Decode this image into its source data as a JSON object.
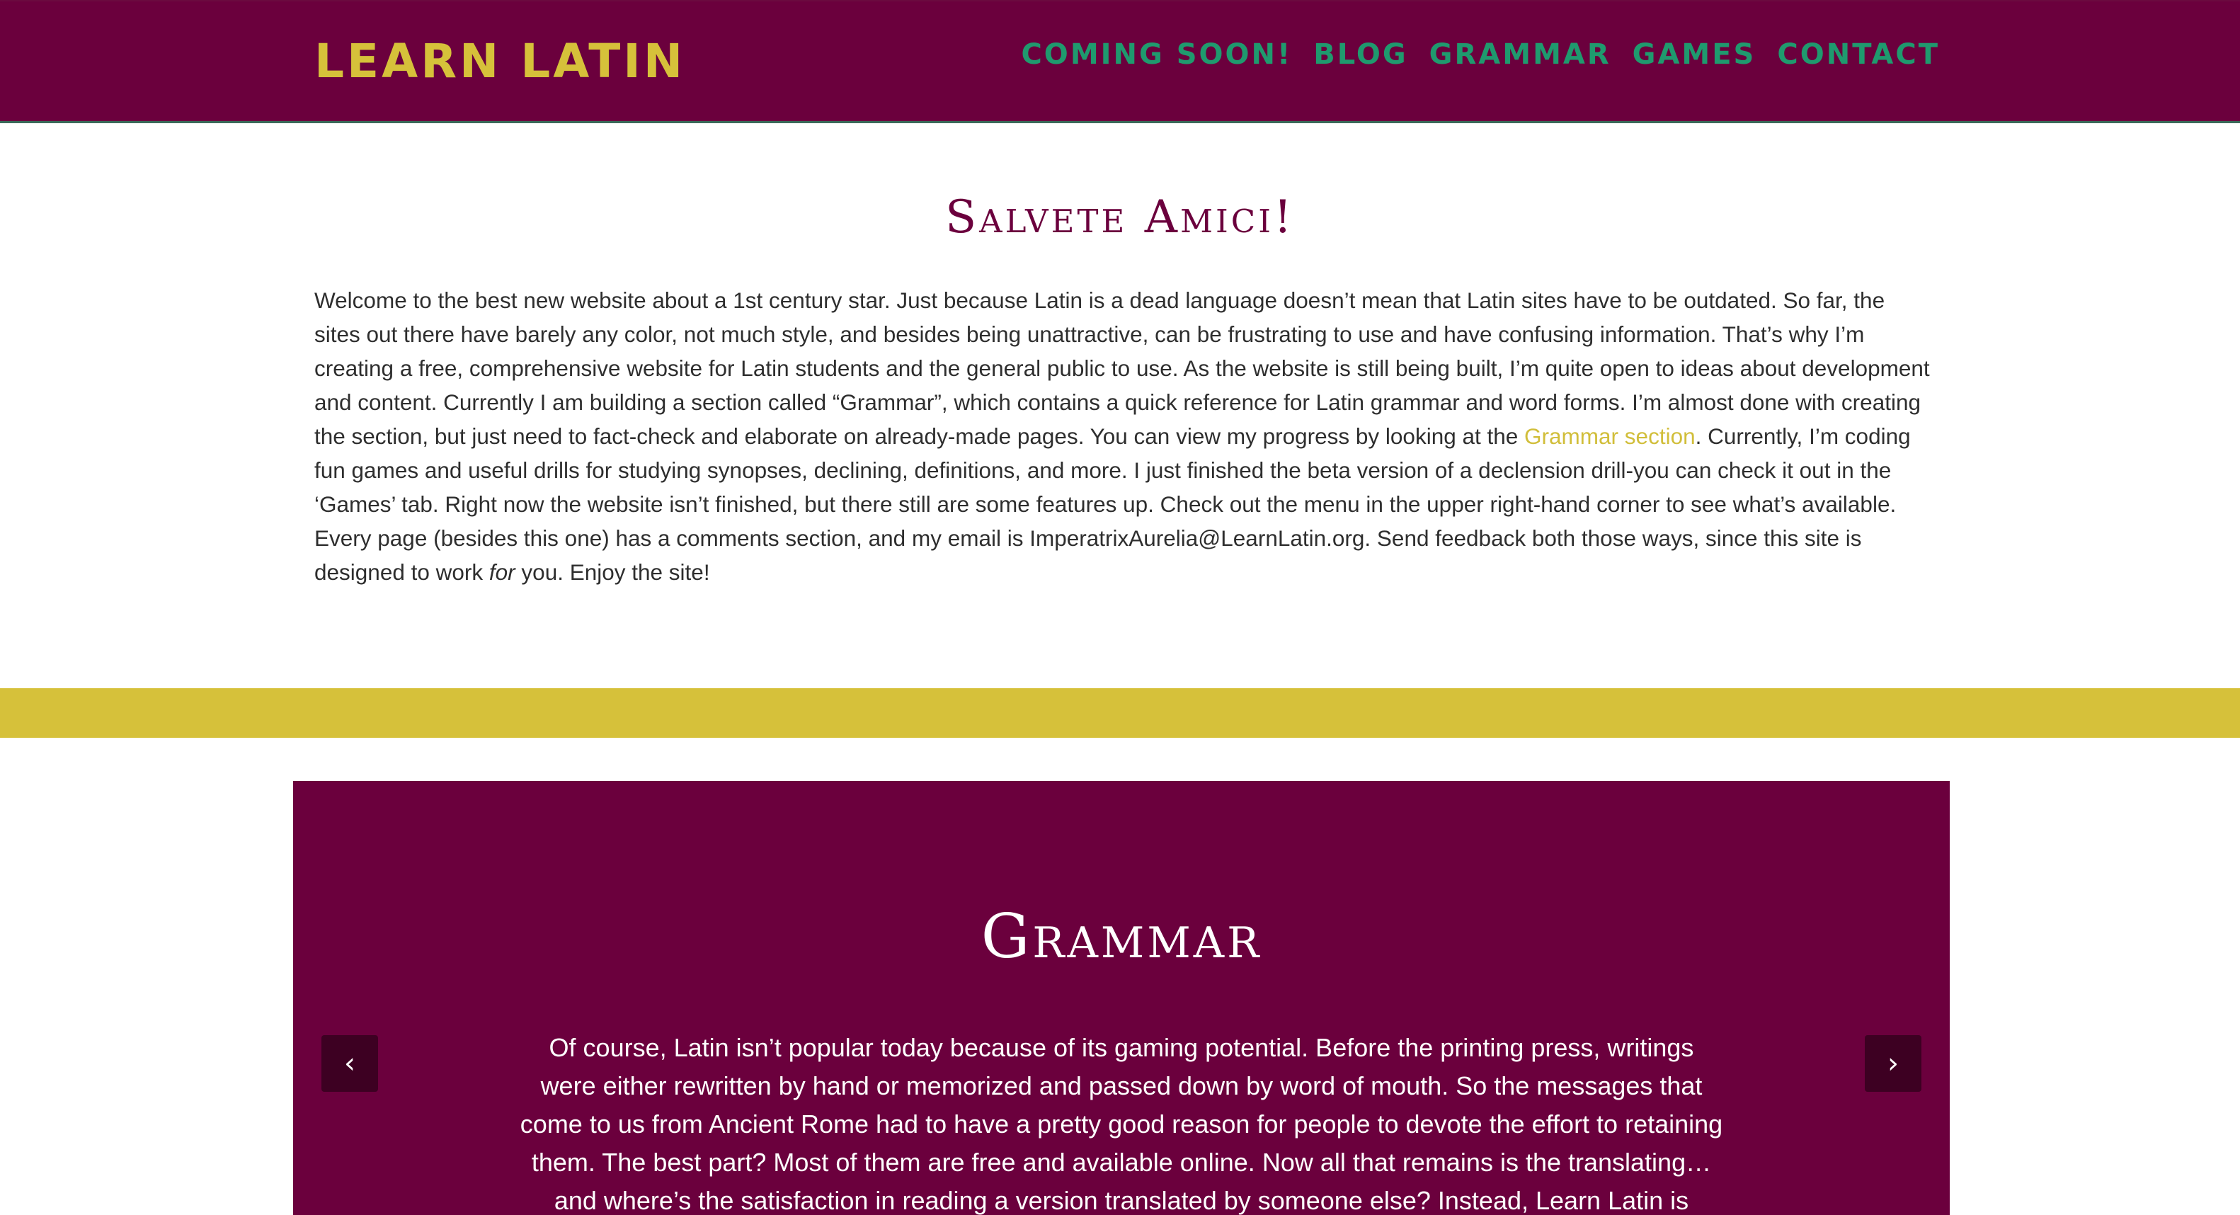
{
  "header": {
    "logo": "LEARN LATIN",
    "nav": [
      "COMING SOON!",
      "BLOG",
      "GRAMMAR",
      "GAMES",
      "CONTACT"
    ]
  },
  "welcome": {
    "title": "Salvete Amici!",
    "paragraph_part1": "Welcome to the best new website about a 1st century star. Just because Latin is a dead language doesn’t mean that Latin sites have to be outdated. So far, the sites out there have barely any color, not much style, and besides being unattractive, can be frustrating to use and have confusing information. That’s why I’m creating a free, comprehensive website for Latin students and the general public to use. As the website is still being built, I’m quite open to ideas about development and content. Currently I am building a section called “Grammar”, which contains a quick reference for Latin grammar and word forms. I’m almost done with creating the section, but just need to fact-check and elaborate on already-made pages. You can view my progress by looking at the ",
    "link": "Grammar section",
    "paragraph_part2": ". Currently, I’m coding fun games and useful drills for studying synopses, declining, definitions, and more. I just finished the beta version of a declension drill-you can check it out in the ‘Games’ tab. Right now the website isn’t finished, but there still are some features up. Check out the menu in the upper right-hand corner to see what’s available. Every page (besides this one) has a comments section, and my email is ImperatrixAurelia@LearnLatin.org. Send feedback both those ways, since this site is designed to work ",
    "emphasis": "for",
    "paragraph_part3": " you. Enjoy the site!"
  },
  "carousel": {
    "title": "Grammar",
    "text": "Of course, Latin isn’t popular today because of its gaming potential. Before the printing press, writings were either rewritten by hand or memorized and passed down by word of mouth. So the messages that come to us from Ancient Rome had to have a pretty good reason for people to devote the effort to retaining them. The best part? Most of them are free and available online. Now all that remains is the translating… and where’s the satisfaction in reading a version translated by someone else? Instead, Learn Latin is currently building a quick",
    "prev_icon": "‹",
    "next_icon": "›"
  },
  "colors": {
    "primary": "#6b003d",
    "accent": "#d6c13a",
    "nav": "#1f9a6e"
  }
}
